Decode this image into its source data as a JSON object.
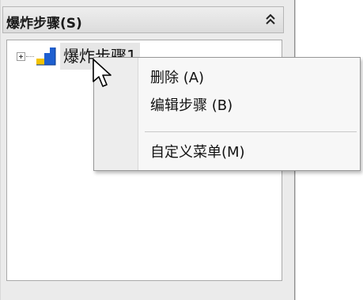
{
  "panel": {
    "title": "爆炸步骤(S)",
    "collapse_icon": "double-chevron-up-icon"
  },
  "tree": {
    "items": [
      {
        "label": "爆炸步骤1",
        "icon": "explode-step-icon",
        "expanded": false,
        "selected": true
      }
    ]
  },
  "context_menu": {
    "items": [
      {
        "label": "删除 (A)"
      },
      {
        "label": "编辑步骤 (B)"
      },
      {
        "label": "自定义菜单(M)"
      }
    ]
  },
  "colors": {
    "panel_bg": "#ebebeb",
    "tree_bg": "#ffffff",
    "menu_bg": "#f7f7f7",
    "icon_blue": "#1e5fd0",
    "icon_yellow": "#f2c200"
  }
}
